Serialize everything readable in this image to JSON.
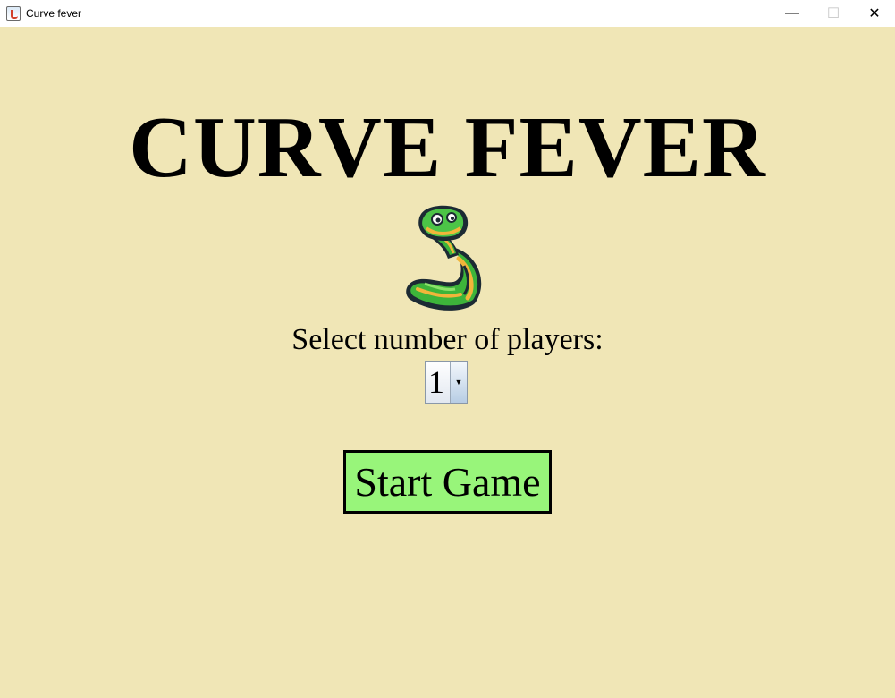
{
  "window": {
    "title": "Curve fever",
    "minimize_glyph": "—",
    "maximize_glyph": "☐",
    "close_glyph": "✕"
  },
  "game": {
    "title": "CURVE FEVER",
    "logo_icon": "snake-icon",
    "prompt": "Select number of players:",
    "players_selected": "1",
    "start_label": "Start Game"
  },
  "colors": {
    "background": "#f0e6b6",
    "start_button": "#98f57a",
    "titlebar": "#ffffff"
  }
}
